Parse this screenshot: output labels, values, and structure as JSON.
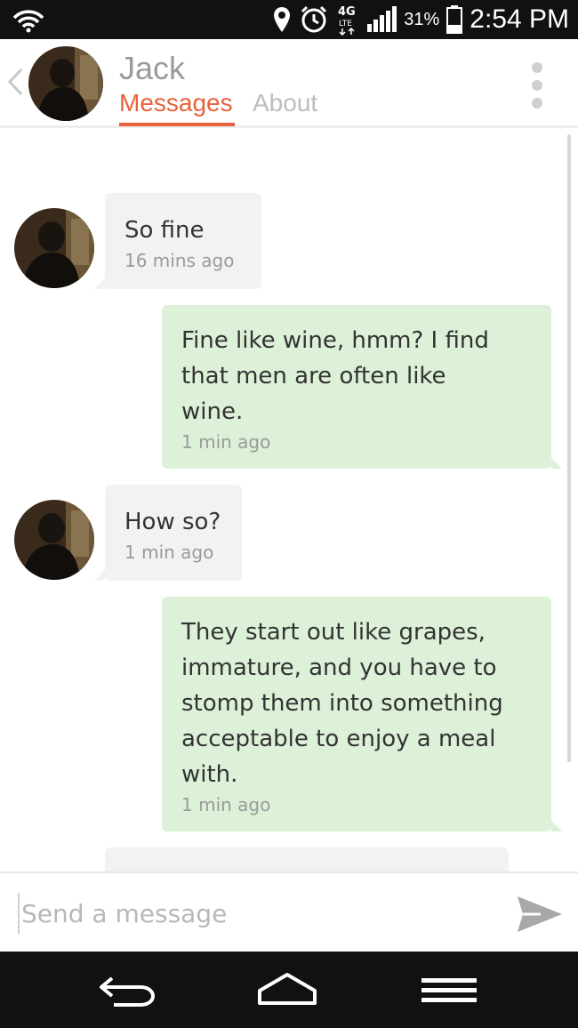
{
  "status_bar": {
    "network": "4G LTE",
    "battery_percent": "31%",
    "time": "2:54 PM",
    "icons": [
      "wifi-icon",
      "location-icon",
      "alarm-icon",
      "lte-icon",
      "signal-icon",
      "battery-icon"
    ]
  },
  "header": {
    "contact_name": "Jack",
    "tabs": [
      {
        "label": "Messages",
        "active": true
      },
      {
        "label": "About",
        "active": false
      }
    ],
    "accent_color": "#e9613c"
  },
  "messages": [
    {
      "direction": "incoming",
      "text": "So fine",
      "time": "16 mins ago"
    },
    {
      "direction": "outgoing",
      "text": "Fine like wine, hmm? I find\nthat men are often like\nwine.",
      "time": "1 min ago"
    },
    {
      "direction": "incoming",
      "text": "How so?",
      "time": "1 min ago"
    },
    {
      "direction": "outgoing",
      "text": "They start out like grapes,\nimmature, and you have to\nstomp them into something\nacceptable to enjoy a meal\nwith.",
      "time": "1 min ago"
    }
  ],
  "composer": {
    "placeholder": "Send a message"
  },
  "colors": {
    "incoming_bubble": "#f2f2f2",
    "outgoing_bubble": "#dcf1d7"
  }
}
